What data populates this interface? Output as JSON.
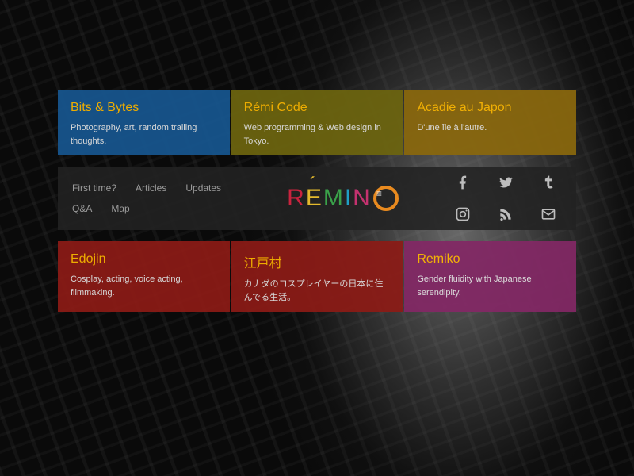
{
  "cards_top": [
    {
      "title": "Bits & Bytes",
      "desc": "Photography, art, random trailing thoughts.",
      "color": "c-blue"
    },
    {
      "title": "Rémi Code",
      "desc": "Web programming & Web design in Tokyo.",
      "color": "c-olive"
    },
    {
      "title": "Acadie au Japon",
      "desc": "D'une île à l'autre.",
      "color": "c-brown"
    }
  ],
  "cards_bottom": [
    {
      "title": "Edojin",
      "desc": "Cosplay, acting, voice acting, filmmaking.",
      "color": "c-red"
    },
    {
      "title": "江戸村",
      "desc": "カナダのコスプレイヤーの日本に住んでる生活。",
      "color": "c-red2"
    },
    {
      "title": "Remiko",
      "desc": "Gender fluidity with Japanese serendipity.",
      "color": "c-purple"
    }
  ],
  "nav": {
    "links": [
      "First time?",
      "Articles",
      "Updates",
      "Q&A",
      "Map"
    ],
    "logo_letters": [
      "R",
      "E",
      "M",
      "I",
      "N",
      "≡"
    ]
  },
  "social": [
    "facebook",
    "twitter",
    "tumblr",
    "instagram",
    "rss",
    "email"
  ]
}
